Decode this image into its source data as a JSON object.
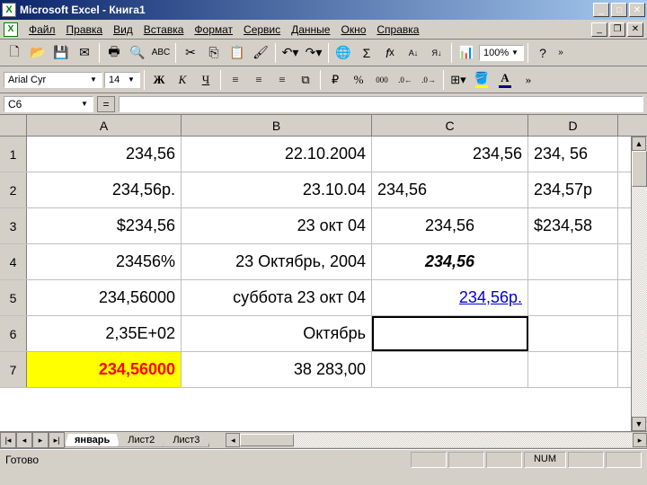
{
  "window": {
    "title": "Microsoft Excel - Книга1"
  },
  "menu": {
    "items": [
      "Файл",
      "Правка",
      "Вид",
      "Вставка",
      "Формат",
      "Сервис",
      "Данные",
      "Окно",
      "Справка"
    ]
  },
  "toolbar1": {
    "zoom": "100%"
  },
  "formatbar": {
    "font": "Arial Cyr",
    "size": "14",
    "bold": "Ж",
    "italic": "К",
    "underline": "Ч",
    "currency": "%",
    "thousands": "000"
  },
  "formula_bar": {
    "name_box": "C6",
    "eq": "=",
    "value": ""
  },
  "columns": [
    "A",
    "B",
    "C",
    "D"
  ],
  "rows": [
    {
      "n": "1",
      "A": "234,56",
      "B": "22.10.2004",
      "C": "234,56",
      "D": "234, 56"
    },
    {
      "n": "2",
      "A": "234,56р.",
      "B": "23.10.04",
      "C": "234,56",
      "D": "234,57р"
    },
    {
      "n": "3",
      "A": "$234,56",
      "B": "23 окт 04",
      "C": "234,56",
      "D": "$234,58"
    },
    {
      "n": "4",
      "A": "23456%",
      "B": "23 Октябрь, 2004",
      "C": "234,56",
      "D": ""
    },
    {
      "n": "5",
      "A": "234,56000",
      "B": "суббота 23 окт 04",
      "C": "234,56р.",
      "D": ""
    },
    {
      "n": "6",
      "A": "2,35E+02",
      "B": "Октябрь",
      "C": "",
      "D": ""
    },
    {
      "n": "7",
      "A": "234,56000",
      "B": "38 283,00",
      "C": "",
      "D": ""
    }
  ],
  "tabs": [
    "январь",
    "Лист2",
    "Лист3"
  ],
  "status": {
    "ready": "Готово",
    "num": "NUM"
  },
  "colors": {
    "titlebar": "#0a246a",
    "accent_yellow": "#ffff00",
    "accent_red": "#ff0000",
    "accent_blue": "#0000cc"
  }
}
